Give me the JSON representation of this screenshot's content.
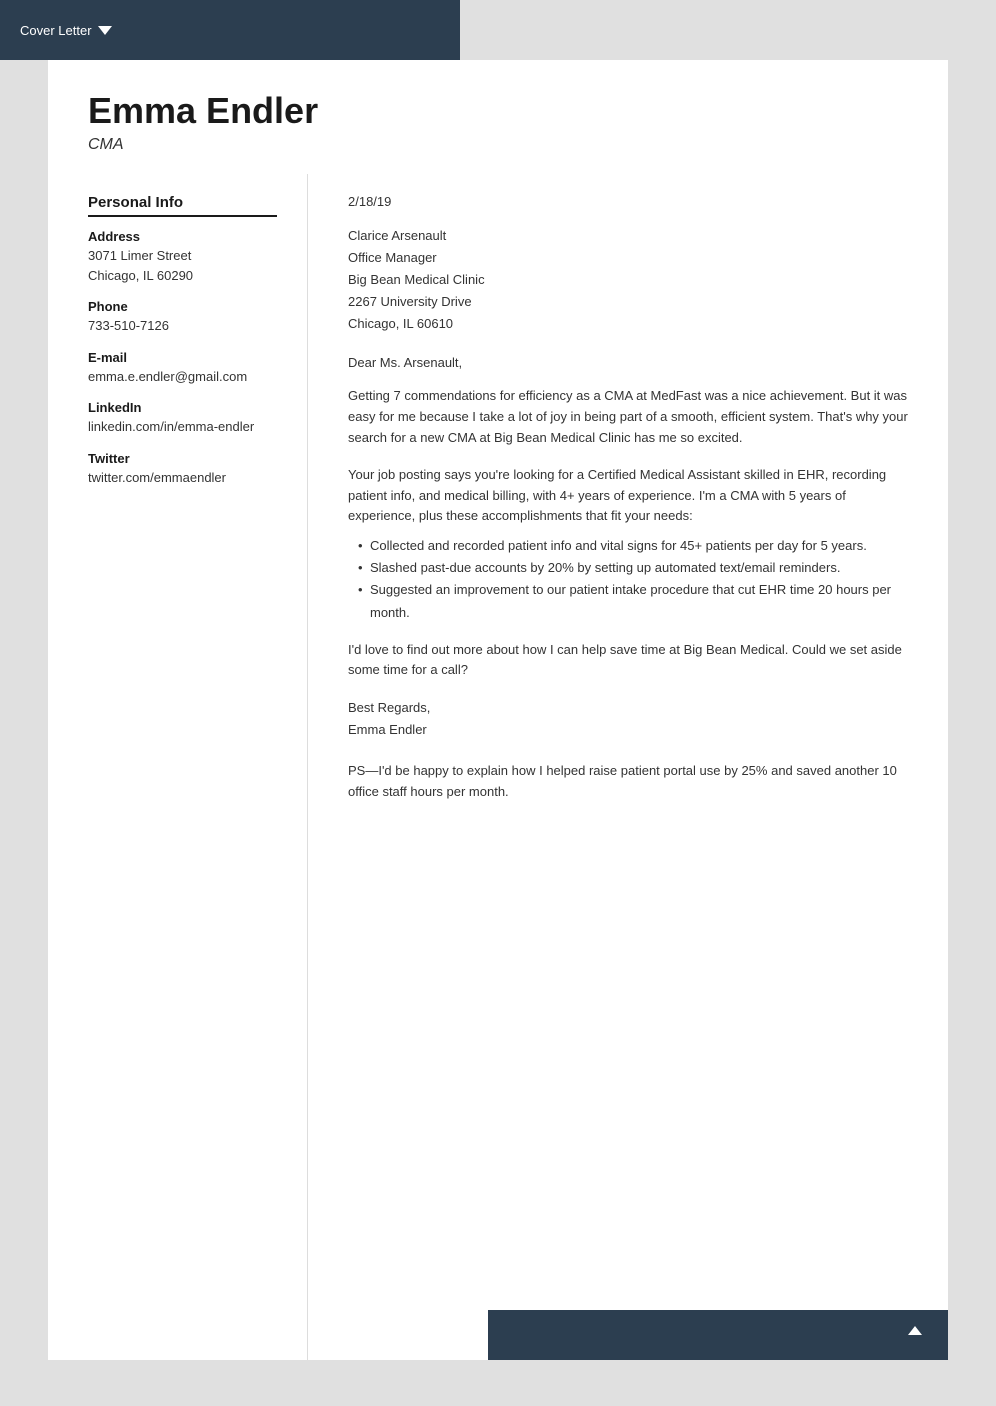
{
  "topbar": {
    "label": "Cover Letter"
  },
  "header": {
    "name": "Emma Endler",
    "subtitle": "CMA"
  },
  "sidebar": {
    "section_title": "Personal Info",
    "address_label": "Address",
    "address_line1": "3071 Limer Street",
    "address_line2": "Chicago, IL 60290",
    "phone_label": "Phone",
    "phone_value": "733-510-7126",
    "email_label": "E-mail",
    "email_value": "emma.e.endler@gmail.com",
    "linkedin_label": "LinkedIn",
    "linkedin_value": "linkedin.com/in/emma-endler",
    "twitter_label": "Twitter",
    "twitter_value": "twitter.com/emmaendler"
  },
  "letter": {
    "date": "2/18/19",
    "recipient_name": "Clarice Arsenault",
    "recipient_title": "Office Manager",
    "recipient_company": "Big Bean Medical Clinic",
    "recipient_address": "2267 University Drive",
    "recipient_city": "Chicago, IL 60610",
    "salutation": "Dear Ms. Arsenault,",
    "paragraph1": "Getting 7 commendations for efficiency as a CMA at MedFast was a nice achievement. But it was easy for me because I take a lot of joy in being part of a smooth, efficient system. That's why your search for a new CMA at Big Bean Medical Clinic has me so excited.",
    "paragraph2": "Your job posting says you're looking for a Certified Medical Assistant skilled in EHR, recording patient info, and medical billing, with 4+ years of experience. I'm a CMA with 5 years of experience, plus these accomplishments that fit your needs:",
    "bullets": [
      "Collected and recorded patient info and vital signs for 45+ patients per day for 5 years.",
      "Slashed past-due accounts by 20% by setting up automated text/email reminders.",
      "Suggested an improvement to our patient intake procedure that cut EHR time 20 hours per month."
    ],
    "paragraph3": "I'd love to find out more about how I can help save time at Big Bean Medical. Could we set aside some time for a call?",
    "closing": "Best Regards,",
    "signoff": "Emma Endler",
    "ps": "PS—I'd be happy to explain how I helped raise patient portal use by 25% and saved another 10 office staff hours per month."
  }
}
